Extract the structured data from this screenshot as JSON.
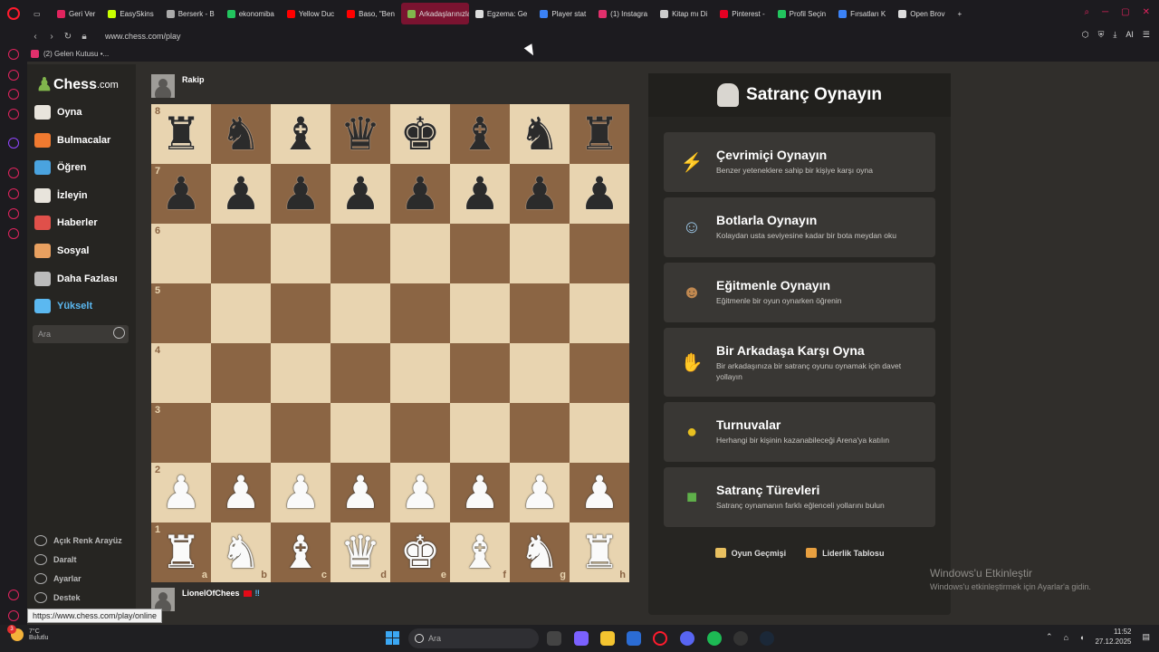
{
  "browser": {
    "tabs": [
      {
        "label": "Geri Ver",
        "color": "#e0245e"
      },
      {
        "label": "EasySkins",
        "color": "#c8ff00"
      },
      {
        "label": "Berserk - B",
        "color": "#aaaaaa"
      },
      {
        "label": "ekonomiba",
        "color": "#22c55e"
      },
      {
        "label": "Yellow Duc",
        "color": "#ff0000"
      },
      {
        "label": "Baso, \"Ben",
        "color": "#ff0000"
      },
      {
        "label": "Arkadaşlarınızla & A",
        "color": "#81b64c"
      },
      {
        "label": "Egzema: Ge",
        "color": "#dddddd"
      },
      {
        "label": "Player stat",
        "color": "#3b82f6"
      },
      {
        "label": "(1) Instagra",
        "color": "#e1306c"
      },
      {
        "label": "Kitap mı Di",
        "color": "#cccccc"
      },
      {
        "label": "Pinterest -",
        "color": "#e60023"
      },
      {
        "label": "Profil Seçin",
        "color": "#22c55e"
      },
      {
        "label": "Fırsatları K",
        "color": "#3b82f6"
      },
      {
        "label": "Open Brov",
        "color": "#dddddd"
      }
    ],
    "active_tab": 6,
    "url": "www.chess.com/play",
    "bookmark": "(2) Gelen Kutusu •...",
    "ai_label": "AI",
    "status_url": "https://www.chess.com/play/online"
  },
  "nav": {
    "brand": "Chess",
    "brand_suffix": ".com",
    "items": [
      {
        "label": "Oyna",
        "color": "#e8e4dc"
      },
      {
        "label": "Bulmacalar",
        "color": "#f07a30"
      },
      {
        "label": "Öğren",
        "color": "#4aa3df"
      },
      {
        "label": "İzleyin",
        "color": "#e8e4dc"
      },
      {
        "label": "Haberler",
        "color": "#e0504a"
      },
      {
        "label": "Sosyal",
        "color": "#e8a060"
      },
      {
        "label": "Daha Fazlası",
        "color": "#bbbbbb"
      },
      {
        "label": "Yükselt",
        "color": "#5bb8f0"
      }
    ],
    "search_placeholder": "Ara",
    "footer": [
      "Açık Renk Arayüz",
      "Daralt",
      "Ayarlar",
      "Destek"
    ]
  },
  "game": {
    "opponent": "Rakip",
    "player": "LionelOfChees",
    "player_badge": "‼",
    "ranks": [
      "8",
      "7",
      "6",
      "5",
      "4",
      "3",
      "2",
      "1"
    ],
    "files": [
      "a",
      "b",
      "c",
      "d",
      "e",
      "f",
      "g",
      "h"
    ],
    "board_rows": [
      [
        "r",
        "n",
        "b",
        "q",
        "k",
        "b",
        "n",
        "r"
      ],
      [
        "p",
        "p",
        "p",
        "p",
        "p",
        "p",
        "p",
        "p"
      ],
      [
        "",
        "",
        "",
        "",
        "",
        "",
        "",
        ""
      ],
      [
        "",
        "",
        "",
        "",
        "",
        "",
        "",
        ""
      ],
      [
        "",
        "",
        "",
        "",
        "",
        "",
        "",
        ""
      ],
      [
        "",
        "",
        "",
        "",
        "",
        "",
        "",
        ""
      ],
      [
        "P",
        "P",
        "P",
        "P",
        "P",
        "P",
        "P",
        "P"
      ],
      [
        "R",
        "N",
        "B",
        "Q",
        "K",
        "B",
        "N",
        "R"
      ]
    ]
  },
  "panel": {
    "title": "Satranç Oynayın",
    "options": [
      {
        "title": "Çevrimiçi Oynayın",
        "desc": "Benzer yeteneklere sahip bir kişiye karşı oyna",
        "icon": "lightning-icon",
        "color": "#f5c518",
        "glyph": "⚡"
      },
      {
        "title": "Botlarla Oynayın",
        "desc": "Kolaydan usta seviyesine kadar bir bota meydan oku",
        "icon": "robot-icon",
        "color": "#9dc8e8",
        "glyph": "☺"
      },
      {
        "title": "Eğitmenle Oynayın",
        "desc": "Eğitmenle bir oyun oynarken öğrenin",
        "icon": "coach-icon",
        "color": "#c08850",
        "glyph": "☻"
      },
      {
        "title": "Bir Arkadaşa Karşı Oyna",
        "desc": "Bir arkadaşınıza bir satranç oyunu oynamak için davet yollayın",
        "icon": "handshake-icon",
        "color": "#d9a878",
        "glyph": "✋"
      },
      {
        "title": "Turnuvalar",
        "desc": "Herhangi bir kişinin kazanabileceği Arena'ya katılın",
        "icon": "medal-icon",
        "color": "#e8c020",
        "glyph": "●"
      },
      {
        "title": "Satranç Türevleri",
        "desc": "Satranç oynamanın farklı eğlenceli yollarını bulun",
        "icon": "variants-cube-icon",
        "color": "#5fb04a",
        "glyph": "■"
      }
    ],
    "links": [
      "Oyun Geçmişi",
      "Liderlik Tablosu"
    ]
  },
  "watermark": {
    "line1": "Windows'u Etkinleştir",
    "line2": "Windows'u etkinleştirmek için Ayarlar'a gidin."
  },
  "taskbar": {
    "weather_temp": "7°C",
    "weather_desc": "Bulutlu",
    "notification_count": "3",
    "search_placeholder": "Ara",
    "time": "11:52",
    "date": "27.12.2025"
  }
}
